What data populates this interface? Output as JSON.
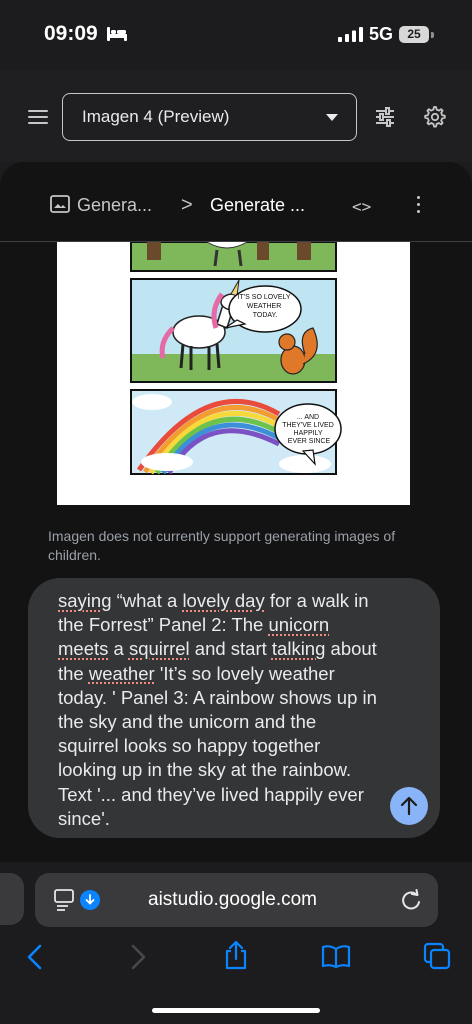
{
  "status_bar": {
    "time": "09:09",
    "network": "5G",
    "battery": "25"
  },
  "toolbar": {
    "model": "Imagen 4 (Preview)"
  },
  "breadcrumb": {
    "first": "Genera...",
    "separator": ">",
    "second": "Generate ..."
  },
  "comic": {
    "speech_1": [
      "IT'S SO LOVELY",
      "WEATHER",
      "TODAY."
    ],
    "speech_2": [
      "... AND",
      "THEY'VE LIVED",
      "HAPPILY",
      "EVER SINCE"
    ]
  },
  "notice": "Imagen does not currently support generating images of children.",
  "prompt": {
    "words": [
      {
        "t": "saying",
        "s": true
      },
      {
        "t": " “what a "
      },
      {
        "t": "lovely day",
        "s": true
      },
      {
        "t": " for a walk in the Forrest” Panel 2: The "
      },
      {
        "t": "unicorn",
        "s": true
      },
      {
        "t": " "
      },
      {
        "t": "meets",
        "s": true
      },
      {
        "t": " a "
      },
      {
        "t": "squirrel",
        "s": true
      },
      {
        "t": " and start "
      },
      {
        "t": "talking",
        "s": true
      },
      {
        "t": " about the "
      },
      {
        "t": "weather",
        "s": true
      },
      {
        "t": " 'It’s so lovely weather today. ' Panel 3: A rainbow shows up in the sky and the unicorn and the squirrel looks so happy together looking up in the sky at the rainbow. Text '... and they’ve lived happily ever since'."
      }
    ]
  },
  "browser": {
    "url": "aistudio.google.com"
  },
  "colors": {
    "accent": "#8ab4f8",
    "panel_bg": "#131314",
    "input_bg": "#333537",
    "spell_error": "#f28b82"
  }
}
